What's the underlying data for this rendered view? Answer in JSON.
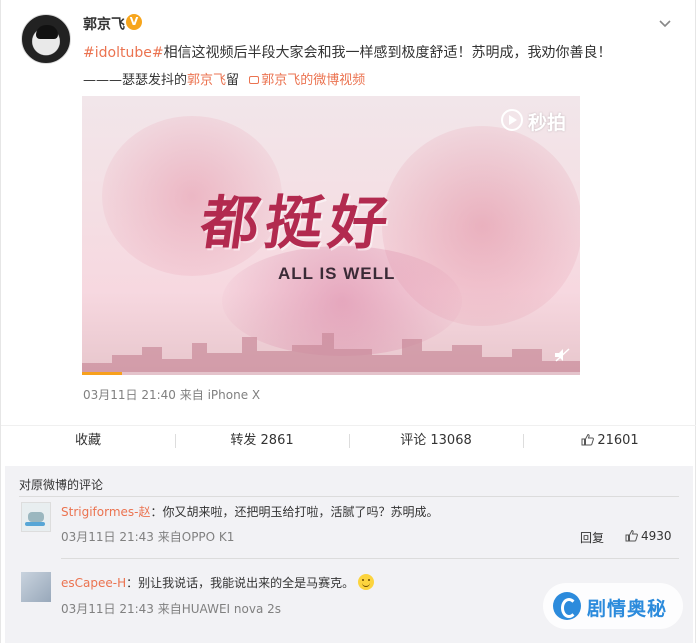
{
  "post": {
    "username": "郭京飞",
    "verified_badge": "V",
    "topic": "#idoltube#",
    "text": "相信这视频后半段大家会和我一样感到极度舒适！苏明成，我劝你善良！",
    "signature_prefix": "———瑟瑟发抖的",
    "signature_user": "郭京飞",
    "signature_suffix": "留",
    "video_link_label": "郭京飞的微博视频",
    "timestamp_source": "03月11日 21:40 来自 iPhone X"
  },
  "video": {
    "title_art": "都挺好",
    "subtitle": "ALL IS WELL",
    "brand": "秒拍",
    "progress_fraction": 0.08
  },
  "actions": {
    "favorite": "收藏",
    "repost": "转发 2861",
    "comment": "评论 13068",
    "like_count": "21601"
  },
  "comments": {
    "header": "对原微博的评论",
    "items": [
      {
        "user": "Strigiformes-赵",
        "separator": "：",
        "text": "你又胡来啦，还把明玉给打啦，活腻了吗？苏明成。",
        "meta": "03月11日 21:43 来自OPPO K1",
        "reply": "回复",
        "likes": "4930"
      },
      {
        "user": "esCapee-H",
        "separator": "：",
        "text": "别让我说话，我能说出来的全是马赛克。",
        "meta": "03月11日 21:43 来自HUAWEI nova 2s"
      }
    ]
  },
  "watermark": {
    "text": "剧情奥秘"
  },
  "colors": {
    "accent": "#eb7350",
    "meta_gray": "#808080",
    "video_progress": "#f7a01c",
    "watermark_blue": "#2c8bdc"
  },
  "icons": {
    "chevron": "chevron-down-icon",
    "like": "thumbs-up-icon",
    "video_link": "video-icon",
    "mute": "mute-icon",
    "brand": "miaopai-logo-icon",
    "emoji": "smiley-icon"
  }
}
